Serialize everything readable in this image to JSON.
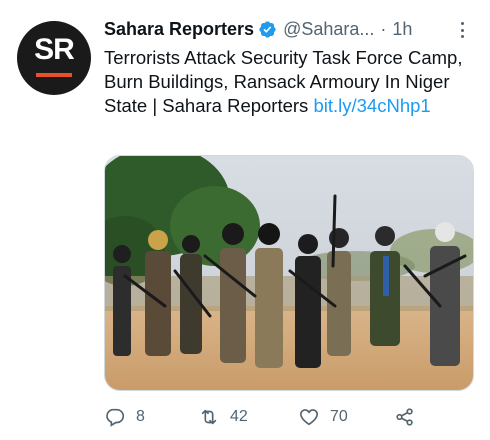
{
  "tweet": {
    "author_name": "Sahara Reporters",
    "handle": "@Sahara...",
    "separator": "·",
    "time": "1h",
    "avatar_text": "SR",
    "text": "Terrorists Attack Security Task Force Camp, Burn Buildings, Ransack Armoury In Niger State | Sahara Reporters",
    "link_text": "bit.ly/34cNhp1"
  },
  "actions": {
    "replies": "8",
    "retweets": "42",
    "likes": "70"
  },
  "colors": {
    "link": "#1d9bf0",
    "verified": "#1d9bf0",
    "muted": "#536471",
    "avatar_bg": "#1a1a1a",
    "avatar_accent": "#e8502a"
  },
  "icons": [
    "verified-badge-icon",
    "more-options-icon",
    "reply-icon",
    "retweet-icon",
    "like-icon",
    "share-icon"
  ]
}
